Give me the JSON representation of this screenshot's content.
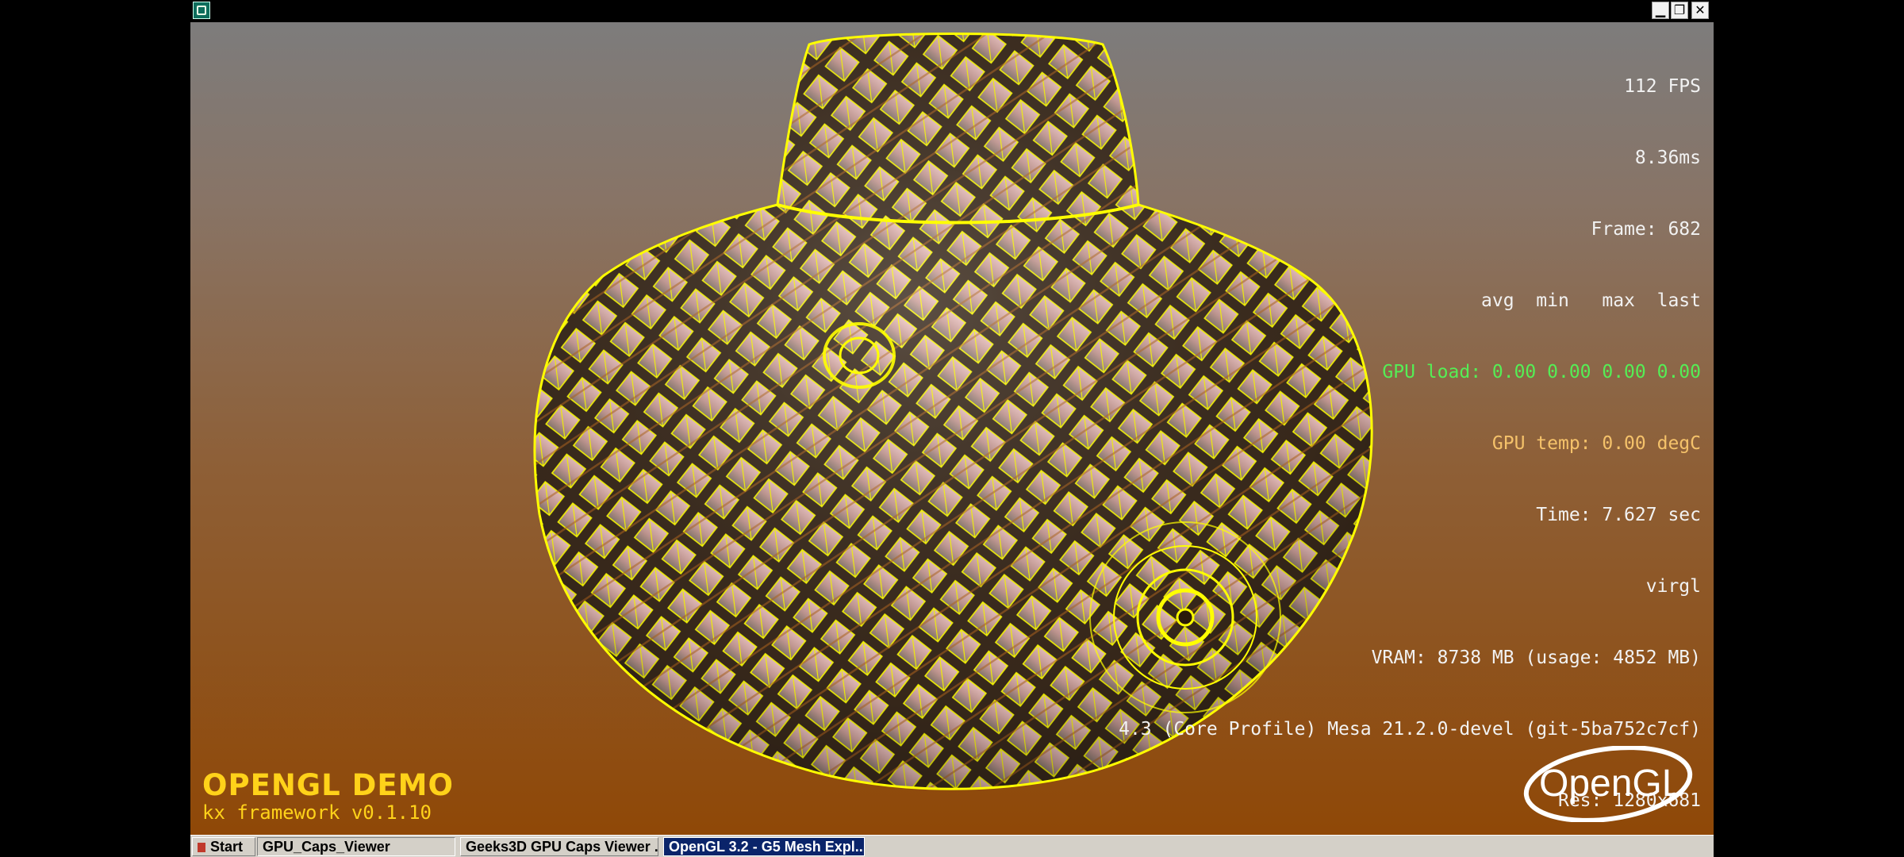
{
  "window": {
    "minimize_glyph": "▁",
    "maximize_glyph": "❐",
    "close_glyph": "✕"
  },
  "stats": {
    "fps": "112 FPS",
    "frame_ms": "8.36ms",
    "frame": "Frame: 682",
    "header": "avg  min   max  last",
    "gpu_load": "GPU load: 0.00 0.00 0.00 0.00",
    "gpu_temp": "GPU temp: 0.00 degC",
    "time": "Time: 7.627 sec",
    "renderer": "virgl",
    "vram": "VRAM: 8738 MB (usage: 4852 MB)",
    "gl_version": "4.3 (Core Profile) Mesa 21.2.0-devel (git-5ba752c7cf)",
    "res": "Res: 1280x681"
  },
  "branding": {
    "title": "OPENGL DEMO",
    "subtitle": "kx framework v0.1.10",
    "logo_text": "OpenGL"
  },
  "taskbar": {
    "start": "Start",
    "tasks": [
      "GPU_Caps_Viewer",
      "Geeks3D GPU Caps Viewer ...",
      "OpenGL 3.2 - G5 Mesh Expl..."
    ]
  },
  "colors": {
    "wire": "#ffff00",
    "panel_top": "#ecc2c0",
    "panel_bottom": "#8a7a70",
    "gpu_load": "#55ee55",
    "gpu_temp": "#f5c26a",
    "brand": "#ffd21a"
  }
}
